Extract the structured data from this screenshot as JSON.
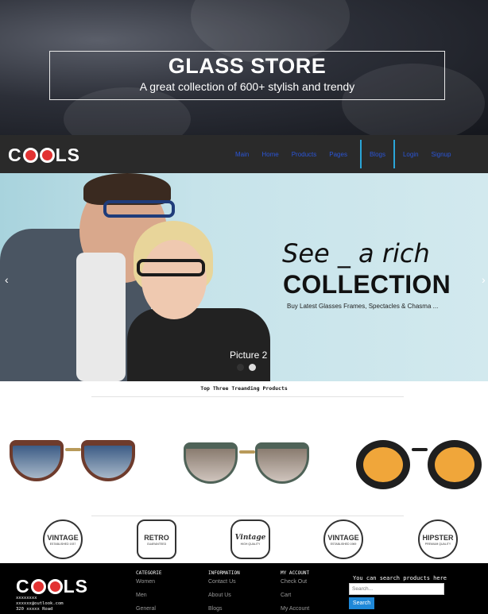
{
  "hero": {
    "title": "GLASS STORE",
    "subtitle": "A great collection of 600+ stylish and trendy"
  },
  "nav": {
    "logo": {
      "start": "C",
      "end": "LS"
    },
    "links": [
      "Main",
      "Home",
      "Products",
      "Pages",
      "Blogs",
      "Login",
      "Signup"
    ]
  },
  "slider": {
    "headline_italic": "See _ a rich",
    "headline_bold": "COLLECTION",
    "tagline": "Buy Latest Glasses Frames, Spectacles & Chasma ...",
    "caption": "Picture 2",
    "prev_arrow": "‹",
    "next_arrow": "›",
    "active_dot": 2,
    "dot_count": 2
  },
  "products": {
    "section_title": "Top Three Treanding Products",
    "items": [
      {
        "name": "cat-eye-blue-gradient-sunglasses",
        "frame_color": "#6e3b2c",
        "lens_color": "#5a7ea6"
      },
      {
        "name": "clubmaster-grey-sunglasses",
        "frame_color": "#4f6358",
        "lens_color": "#a08b80"
      },
      {
        "name": "round-orange-lens-sunglasses",
        "frame_color": "#1f1f1f",
        "lens_color": "#f0a63a"
      }
    ]
  },
  "badges": [
    {
      "title": "VINTAGE",
      "sub": "ESTABLISHED 1937"
    },
    {
      "title": "RETRO",
      "sub": "GUARANTEED"
    },
    {
      "title": "Vintage",
      "sub": "HIGH QUALITY"
    },
    {
      "title": "VINTAGE",
      "sub": "ESTABLISHED 1969"
    },
    {
      "title": "HIPSTER",
      "sub": "PREMIUM QUALITY"
    }
  ],
  "footer": {
    "address": [
      "xxxxxxxx",
      "xxxxxx@outlook.com",
      "320 xxxxx Road"
    ],
    "columns": [
      {
        "title": "CATEGORIE",
        "links": [
          "Women",
          "Men",
          "General"
        ]
      },
      {
        "title": "INFORMATION",
        "links": [
          "Contact Us",
          "About Us",
          "Blogs"
        ]
      },
      {
        "title": "MY ACCOUNT",
        "links": [
          "Check Out",
          "Cart",
          "My Account"
        ]
      }
    ],
    "search_label": "You can search products here",
    "search_placeholder": "Search...",
    "search_button": "Search"
  },
  "colors": {
    "nav_link": "#2b55d6",
    "accent_separator": "#2aa6d8",
    "logo_red": "#e23232",
    "search_button": "#1e88d8"
  }
}
